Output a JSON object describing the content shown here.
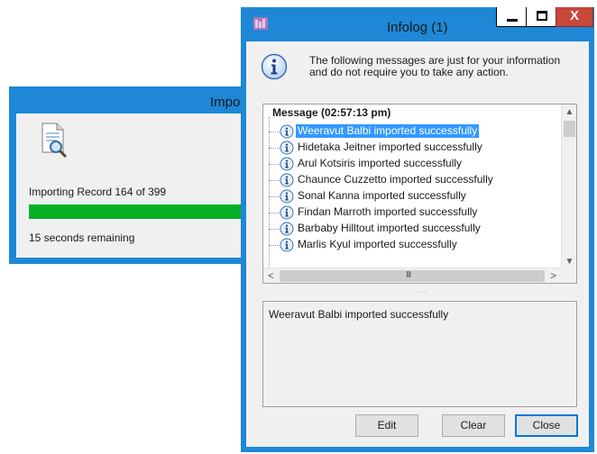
{
  "import_window": {
    "title": "Impo",
    "status_text": "Importing Record 164 of 399",
    "progress_percent": 100,
    "time_remaining": "15 seconds remaining",
    "icon": "document-search-icon",
    "colors": {
      "frame": "#1e88d6",
      "progress": "#06b025"
    }
  },
  "infolog": {
    "title": "Infolog (1)",
    "app_icon": "dynamics-app-icon",
    "window_controls": {
      "minimize": "minimize-icon",
      "maximize": "maximize-icon",
      "close": "X"
    },
    "info_icon": "info-icon",
    "intro_message": "The following messages are just for your information and do not require you to take any action.",
    "tree": {
      "header": "Message (02:57:13 pm)",
      "rows": [
        {
          "text": "Weeravut Balbi imported successfully",
          "selected": true
        },
        {
          "text": "Hidetaka Jeitner imported successfully",
          "selected": false
        },
        {
          "text": "Arul Kotsiris imported successfully",
          "selected": false
        },
        {
          "text": "Chaunce Cuzzetto imported successfully",
          "selected": false
        },
        {
          "text": "Sonal Kanna imported successfully",
          "selected": false
        },
        {
          "text": "Findan Marroth imported successfully",
          "selected": false
        },
        {
          "text": "Barbaby Hilltout imported successfully",
          "selected": false
        },
        {
          "text": "Marlis Kyul imported successfully",
          "selected": false
        }
      ],
      "scroll_arrows": {
        "up": "^",
        "down": "v",
        "left": "<",
        "right": ">",
        "grip": "III"
      }
    },
    "splitter": "....",
    "detail_text": "Weeravut Balbi imported successfully",
    "buttons": {
      "edit": "Edit",
      "clear": "Clear",
      "close": "Close"
    },
    "colors": {
      "frame": "#1e88d6",
      "selection": "#3399ff",
      "close_button": "#c7473a"
    }
  }
}
